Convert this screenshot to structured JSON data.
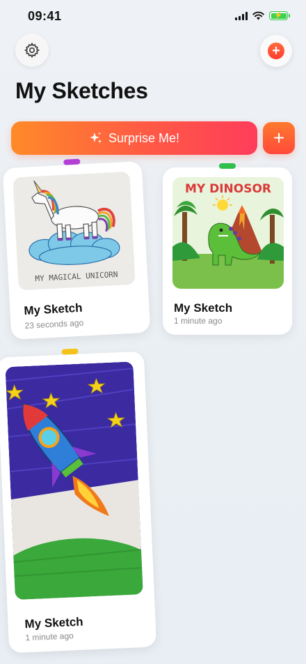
{
  "status_bar": {
    "time": "09:41"
  },
  "header": {
    "title": "My Sketches"
  },
  "actions": {
    "surprise_label": "Surprise Me!"
  },
  "sketches": [
    {
      "title": "My Sketch",
      "time": "23 seconds ago",
      "caption": "MY MAGICAL UNICORN",
      "tab_color": "#b43fd6"
    },
    {
      "title": "My Sketch",
      "time": "1 minute ago",
      "caption": "MY DINOSOR",
      "tab_color": "#2fbf4a"
    },
    {
      "title": "My Sketch",
      "time": "1 minute ago",
      "caption": "",
      "tab_color": "#f5c218"
    }
  ],
  "colors": {
    "accent": "#ff5a45",
    "accent_orange": "#ff8a28"
  }
}
